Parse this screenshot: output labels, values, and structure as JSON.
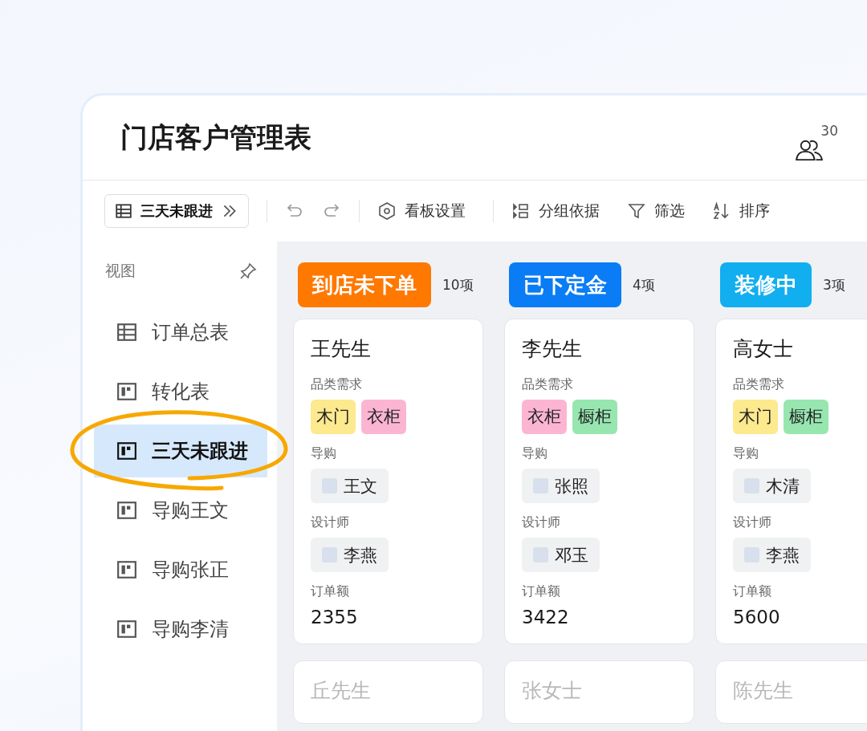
{
  "window": {
    "title": "门店客户管理表",
    "member_count": "30"
  },
  "toolbar": {
    "current_view": "三天未跟进",
    "items": [
      {
        "kind": "settings",
        "label": "看板设置"
      },
      {
        "kind": "group",
        "label": "分组依据"
      },
      {
        "kind": "filter",
        "label": "筛选"
      },
      {
        "kind": "sort",
        "label": "排序"
      }
    ]
  },
  "sidebar": {
    "heading": "视图",
    "items": [
      {
        "kind": "grid",
        "label": "订单总表",
        "selected": false
      },
      {
        "kind": "kanban",
        "label": "转化表",
        "selected": false
      },
      {
        "kind": "kanban",
        "label": "三天未跟进",
        "selected": true
      },
      {
        "kind": "kanban",
        "label": "导购王文",
        "selected": false
      },
      {
        "kind": "kanban",
        "label": "导购张正",
        "selected": false
      },
      {
        "kind": "kanban",
        "label": "导购李清",
        "selected": false
      }
    ]
  },
  "columns": [
    {
      "title": "到店未下单",
      "count": "10项",
      "color": "#ff7800",
      "cards": [
        {
          "name": "王先生",
          "dimmed": false,
          "fields": [
            {
              "kind": "tags",
              "label": "品类需求",
              "tags": [
                {
                  "text": "木门",
                  "color": "#fde98e"
                },
                {
                  "text": "衣柜",
                  "color": "#fbb5d3"
                }
              ]
            },
            {
              "kind": "person",
              "label": "导购",
              "value": "王文"
            },
            {
              "kind": "person",
              "label": "设计师",
              "value": "李燕"
            },
            {
              "kind": "text",
              "label": "订单额",
              "value": "2355"
            }
          ]
        },
        {
          "name": "丘先生",
          "dimmed": true
        }
      ]
    },
    {
      "title": "已下定金",
      "count": "4项",
      "color": "#0a7cf5",
      "cards": [
        {
          "name": "李先生",
          "dimmed": false,
          "fields": [
            {
              "kind": "tags",
              "label": "品类需求",
              "tags": [
                {
                  "text": "衣柜",
                  "color": "#fbb5d3"
                },
                {
                  "text": "橱柜",
                  "color": "#97e6b0"
                }
              ]
            },
            {
              "kind": "person",
              "label": "导购",
              "value": "张照"
            },
            {
              "kind": "person",
              "label": "设计师",
              "value": "邓玉"
            },
            {
              "kind": "text",
              "label": "订单额",
              "value": "3422"
            }
          ]
        },
        {
          "name": "张女士",
          "dimmed": true
        }
      ]
    },
    {
      "title": "装修中",
      "count": "3项",
      "color": "#11aef0",
      "cards": [
        {
          "name": "高女士",
          "dimmed": false,
          "fields": [
            {
              "kind": "tags",
              "label": "品类需求",
              "tags": [
                {
                  "text": "木门",
                  "color": "#fde98e"
                },
                {
                  "text": "橱柜",
                  "color": "#97e6b0"
                }
              ]
            },
            {
              "kind": "person",
              "label": "导购",
              "value": "木清"
            },
            {
              "kind": "person",
              "label": "设计师",
              "value": "李燕"
            },
            {
              "kind": "text",
              "label": "订单额",
              "value": "5600"
            }
          ]
        },
        {
          "name": "陈先生",
          "dimmed": true
        }
      ]
    }
  ]
}
